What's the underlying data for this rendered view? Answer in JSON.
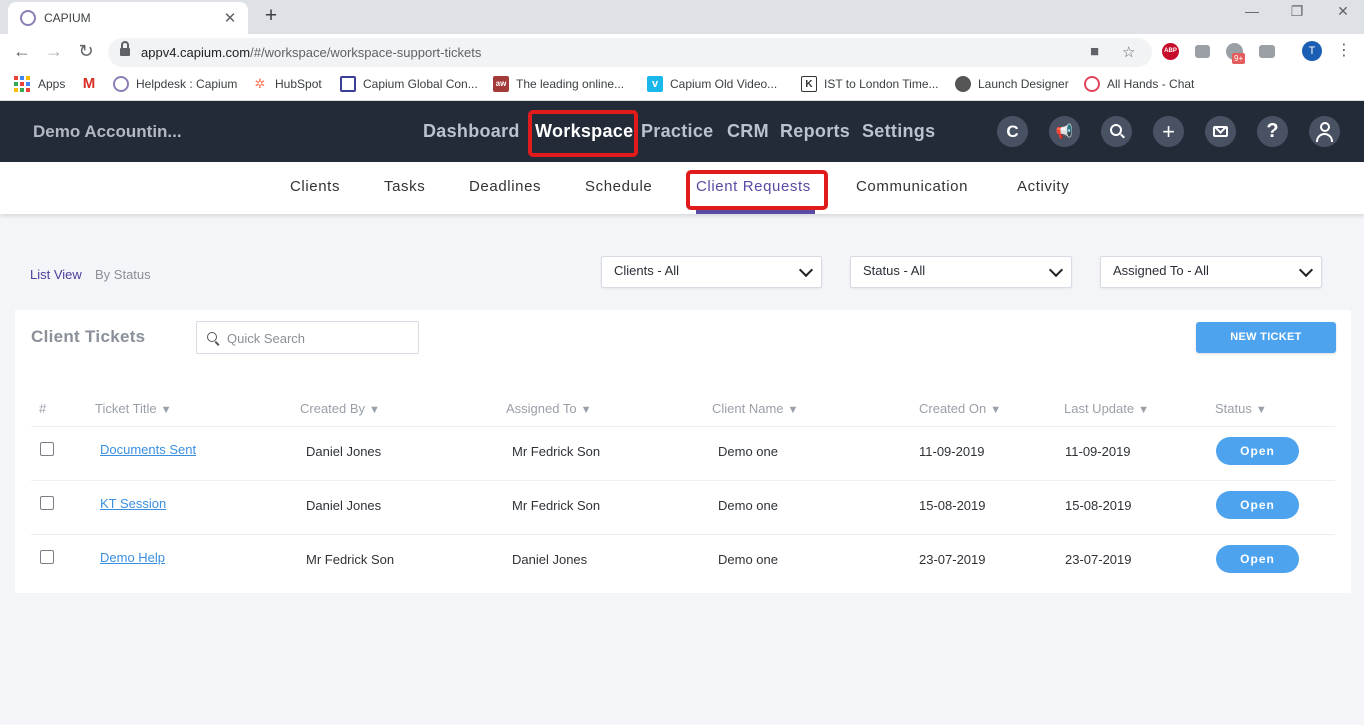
{
  "browser": {
    "tab_title": "CAPIUM",
    "url_host": "appv4.capium.com",
    "url_path": "/#/workspace/workspace-support-tickets",
    "bookmarks": [
      {
        "label": "Apps"
      },
      {
        "label": "M"
      },
      {
        "label": "Helpdesk : Capium"
      },
      {
        "label": "HubSpot"
      },
      {
        "label": "Capium Global Con..."
      },
      {
        "label": "The leading online..."
      },
      {
        "label": "Capium Old Video..."
      },
      {
        "label": "IST to London Time..."
      },
      {
        "label": "Launch Designer"
      },
      {
        "label": "All Hands - Chat"
      }
    ],
    "avatar_letter": "T",
    "abp_label": "ABP",
    "ext_badge": "9+"
  },
  "app": {
    "org_name": "Demo Accountin...",
    "main_nav": [
      "Dashboard",
      "Workspace",
      "Practice",
      "CRM",
      "Reports",
      "Settings"
    ],
    "sub_nav": [
      "Clients",
      "Tasks",
      "Deadlines",
      "Schedule",
      "Client Requests",
      "Communication",
      "Activity"
    ],
    "header_icons": [
      "capium-logo-icon",
      "megaphone-icon",
      "search-icon",
      "plus-icon",
      "mail-icon",
      "help-icon",
      "user-icon"
    ],
    "accent": "#5b4aa3",
    "highlight_color": "#e11b1b"
  },
  "filters": {
    "list_view": "List View",
    "by_status": "By Status",
    "clients": "Clients - All",
    "status": "Status - All",
    "assigned_to": "Assigned To - All"
  },
  "tickets": {
    "title": "Client Tickets",
    "search_placeholder": "Quick Search",
    "new_ticket": "NEW TICKET",
    "columns": [
      "#",
      "Ticket Title",
      "Created By",
      "Assigned To",
      "Client Name",
      "Created On",
      "Last Update",
      "Status"
    ],
    "rows": [
      {
        "title": "Documents Sent",
        "created_by": "Daniel Jones",
        "assigned_to": "Mr Fedrick Son",
        "client": "Demo one",
        "created_on": "11-09-2019",
        "last_update": "11-09-2019",
        "status": "Open"
      },
      {
        "title": "KT Session",
        "created_by": "Daniel Jones",
        "assigned_to": "Mr Fedrick Son",
        "client": "Demo one",
        "created_on": "15-08-2019",
        "last_update": "15-08-2019",
        "status": "Open"
      },
      {
        "title": "Demo Help",
        "created_by": "Mr Fedrick Son",
        "assigned_to": "Daniel Jones",
        "client": "Demo one",
        "created_on": "23-07-2019",
        "last_update": "23-07-2019",
        "status": "Open"
      }
    ]
  }
}
